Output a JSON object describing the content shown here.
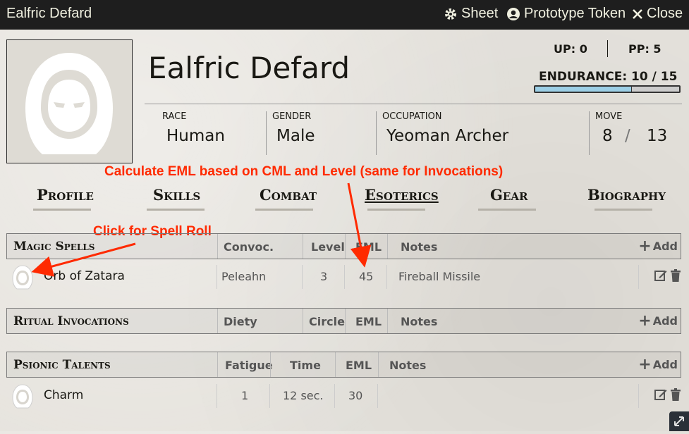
{
  "window": {
    "title": "Ealfric Defard",
    "sheet_label": "Sheet",
    "token_label": "Prototype Token",
    "close_label": "Close"
  },
  "character": {
    "name": "Ealfric Defard",
    "up": "UP: 0",
    "pp": "PP: 5",
    "endurance": "ENDURANCE: 10 / 15",
    "endurance_fraction": 0.667,
    "race_label": "RACE",
    "race": "Human",
    "gender_label": "GENDER",
    "gender": "Male",
    "occupation_label": "OCCUPATION",
    "occupation": "Yeoman Archer",
    "move_label": "MOVE",
    "move_a": "8",
    "move_slash": "/",
    "move_b": "13"
  },
  "annotations": {
    "eml_note": "Calculate EML based on CML and Level (same for Invocations)",
    "spell_roll_note": "Click for Spell Roll",
    "color": "#ff2a00"
  },
  "tabs": [
    "Profile",
    "Skills",
    "Combat",
    "Esoterics",
    "Gear",
    "Biography"
  ],
  "active_tab": "Esoterics",
  "magic_spells": {
    "title": "Magic Spells",
    "cols": [
      "Convoc.",
      "Level",
      "EML",
      "Notes"
    ],
    "add_label": "Add",
    "rows": [
      {
        "name": "Orb of Zatara",
        "convoc": "Peleahn",
        "level": "3",
        "eml": "45",
        "notes": "Fireball Missile"
      }
    ]
  },
  "ritual_invocations": {
    "title": "Ritual Invocations",
    "cols": [
      "Diety",
      "Circle",
      "EML",
      "Notes"
    ],
    "add_label": "Add"
  },
  "psionic_talents": {
    "title": "Psionic Talents",
    "cols": [
      "Fatigue",
      "Time",
      "EML",
      "Notes"
    ],
    "add_label": "Add",
    "rows": [
      {
        "name": "Charm",
        "fatigue": "1",
        "time": "12 sec.",
        "eml": "30",
        "notes": ""
      }
    ]
  }
}
